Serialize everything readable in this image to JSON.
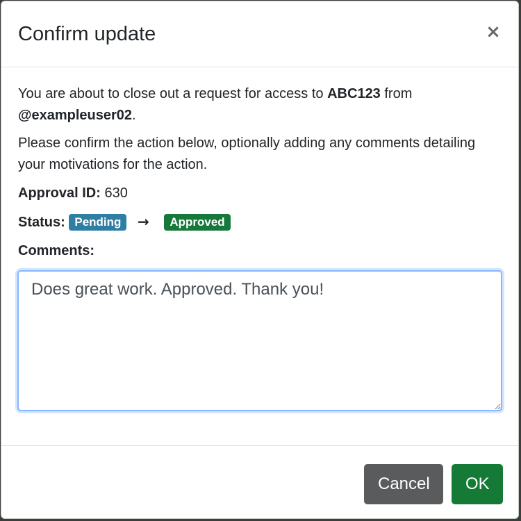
{
  "modal": {
    "title": "Confirm update",
    "close_glyph": "×"
  },
  "body": {
    "intro_prefix": "You are about to close out a request for access to ",
    "resource": "ABC123",
    "intro_mid": " from ",
    "user": "@exampleuser02",
    "intro_suffix": ".",
    "instruction": "Please confirm the action below, optionally adding any comments detailing your motivations for the action.",
    "approval_id_label": "Approval ID:",
    "approval_id_value": "630",
    "status_label": "Status:",
    "status_from": "Pending",
    "status_arrow": "→",
    "status_to": "Approved",
    "comments_label": "Comments:",
    "comments_value": "Does great work. Approved. Thank you!"
  },
  "footer": {
    "cancel_label": "Cancel",
    "ok_label": "OK"
  },
  "colors": {
    "pending_badge": "#2f7ea4",
    "approved_badge": "#16783a",
    "cancel_button": "#5a5b5d",
    "ok_button": "#157a36",
    "focus_border": "#86b7fe"
  }
}
